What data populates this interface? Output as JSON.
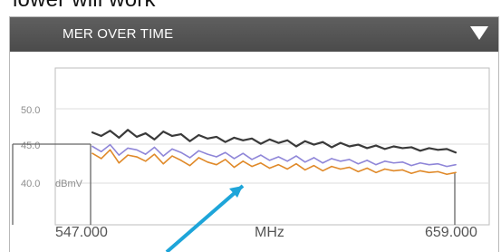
{
  "caption_fragment": "lower will work",
  "panel": {
    "title": "MER OVER TIME",
    "dropdown_icon": "triangle-down-icon"
  },
  "chart_data": {
    "type": "line",
    "title": "",
    "xlabel": "MHz",
    "ylabel": "dBmV",
    "x_ticks": [
      "547.000",
      "659.000"
    ],
    "y_ticks": [
      "50.0",
      "45.0",
      "40.0"
    ],
    "unit_label": "dBmV",
    "xlim": [
      547.0,
      659.0
    ],
    "ylim": [
      35.0,
      53.0
    ],
    "series": [
      {
        "color": "#3a3a3a",
        "values": [
          45.6,
          45.2,
          45.8,
          45.0,
          45.9,
          45.1,
          45.5,
          44.8,
          45.7,
          45.2,
          45.4,
          44.6,
          45.3,
          44.9,
          45.1,
          44.5,
          45.0,
          44.7,
          44.9,
          44.3,
          44.8,
          44.4,
          44.7,
          44.0,
          44.6,
          44.2,
          44.5,
          43.9,
          44.4,
          44.0,
          44.2,
          43.8,
          44.1,
          43.7,
          44.0,
          43.8,
          43.9,
          43.5,
          43.8,
          43.6,
          43.7,
          43.3
        ]
      },
      {
        "color": "#e08a2a",
        "values": [
          43.2,
          42.6,
          43.6,
          42.1,
          43.0,
          42.8,
          42.3,
          43.1,
          42.0,
          42.9,
          42.4,
          41.8,
          42.7,
          42.2,
          41.9,
          42.5,
          41.6,
          42.3,
          41.7,
          42.1,
          41.5,
          41.9,
          41.4,
          42.0,
          41.3,
          41.8,
          41.2,
          41.7,
          41.4,
          41.6,
          41.1,
          41.5,
          41.0,
          41.4,
          41.2,
          41.3,
          40.9,
          41.2,
          41.0,
          41.1,
          40.8,
          41.0
        ]
      },
      {
        "color": "#8f86d8",
        "values": [
          44.0,
          43.4,
          44.2,
          43.0,
          43.8,
          43.6,
          43.1,
          43.9,
          42.9,
          43.7,
          43.3,
          42.7,
          43.5,
          43.1,
          42.8,
          43.3,
          42.6,
          43.2,
          42.5,
          43.0,
          42.4,
          42.8,
          42.3,
          42.9,
          42.2,
          42.7,
          42.1,
          42.6,
          42.3,
          42.5,
          42.0,
          42.4,
          41.9,
          42.3,
          42.1,
          42.2,
          41.8,
          42.1,
          41.9,
          42.0,
          41.7,
          41.9
        ]
      }
    ],
    "colors": {
      "gridline": "#d7d7d7",
      "border": "#b3b3b3",
      "accent_arrow": "#1ea5d9"
    }
  }
}
